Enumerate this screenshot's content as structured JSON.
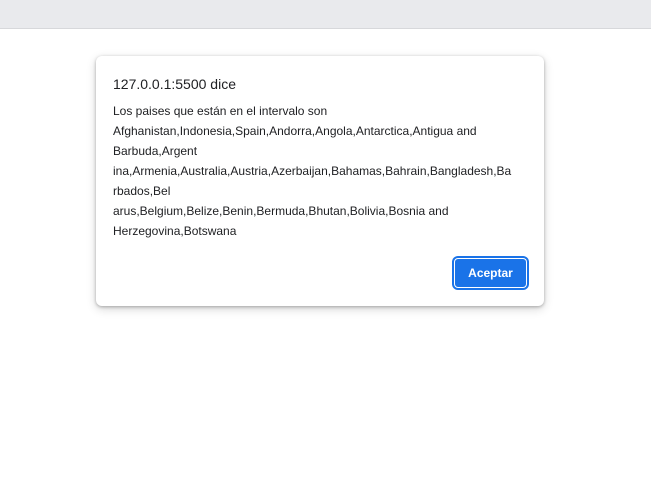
{
  "dialog": {
    "title": "127.0.0.1:5500 dice",
    "message_lines": [
      "Los paises que están en el intervalo son",
      "Afghanistan,Indonesia,Spain,Andorra,Angola,Antarctica,Antigua and",
      "Barbuda,Argent",
      "ina,Armenia,Australia,Austria,Azerbaijan,Bahamas,Bahrain,Bangladesh,Ba",
      "rbados,Bel",
      "arus,Belgium,Belize,Benin,Bermuda,Bhutan,Bolivia,Bosnia and",
      "Herzegovina,Botswana"
    ],
    "ok_label": "Aceptar"
  },
  "colors": {
    "accent": "#1a73e8",
    "browser_strip": "#e9eaed"
  }
}
